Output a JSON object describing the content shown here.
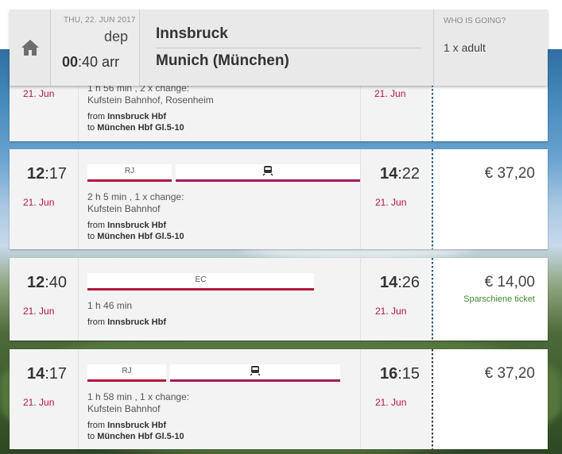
{
  "header": {
    "date": "THU, 22. JUN 2017",
    "dep_label": "dep",
    "time_hours": "00",
    "time_rest": ":40 arr",
    "from_city": "Innsbruck",
    "to_city": "Munich (München)",
    "who_label": "WHO IS GOING?",
    "who_value": "1 x adult"
  },
  "partial_row": {
    "day": "21. Jun",
    "info_line1": "1 h 56 min , 2 x change:",
    "info_line2": "Kufstein Bahnhof, Rosenheim",
    "from_prefix": "from ",
    "from_station": "Innsbruck Hbf",
    "to_prefix": "to ",
    "to_station": "München Hbf Gl.5-10",
    "arr_day": "21. Jun"
  },
  "rows": [
    {
      "dep_h": "12",
      "dep_m": ":17",
      "dep_day": "21. Jun",
      "train1": "RJ",
      "info_line1": "2 h 5 min , 1 x change:",
      "info_line2": "Kufstein Bahnhof",
      "from_prefix": "from ",
      "from_station": "Innsbruck Hbf",
      "to_prefix": "to ",
      "to_station": "München Hbf Gl.5-10",
      "arr_h": "14",
      "arr_m": ":22",
      "arr_day": "21. Jun",
      "price": "€ 37,20"
    },
    {
      "dep_h": "12",
      "dep_m": ":40",
      "dep_day": "21. Jun",
      "train1": "EC",
      "info_line1": "1 h 46 min",
      "from_prefix": "from ",
      "from_station": "Innsbruck Hbf",
      "arr_h": "14",
      "arr_m": ":26",
      "arr_day": "21. Jun",
      "price": "€ 14,00",
      "price_note": "Sparschiene ticket"
    },
    {
      "dep_h": "14",
      "dep_m": ":17",
      "dep_day": "21. Jun",
      "train1": "RJ",
      "info_line1": "1 h 58 min , 1 x change:",
      "info_line2": "Kufstein Bahnhof",
      "from_prefix": "from ",
      "from_station": "Innsbruck Hbf",
      "to_prefix": "to ",
      "to_station": "München Hbf Gl.5-10",
      "arr_h": "16",
      "arr_m": ":15",
      "arr_day": "21. Jun",
      "price": "€ 37,20"
    }
  ],
  "icons": {
    "home": "home-icon",
    "train": "train-icon"
  },
  "colors": {
    "accent_red": "#b0173b",
    "accent_magenta": "#a3195b",
    "green_note": "#3f8a2f"
  }
}
